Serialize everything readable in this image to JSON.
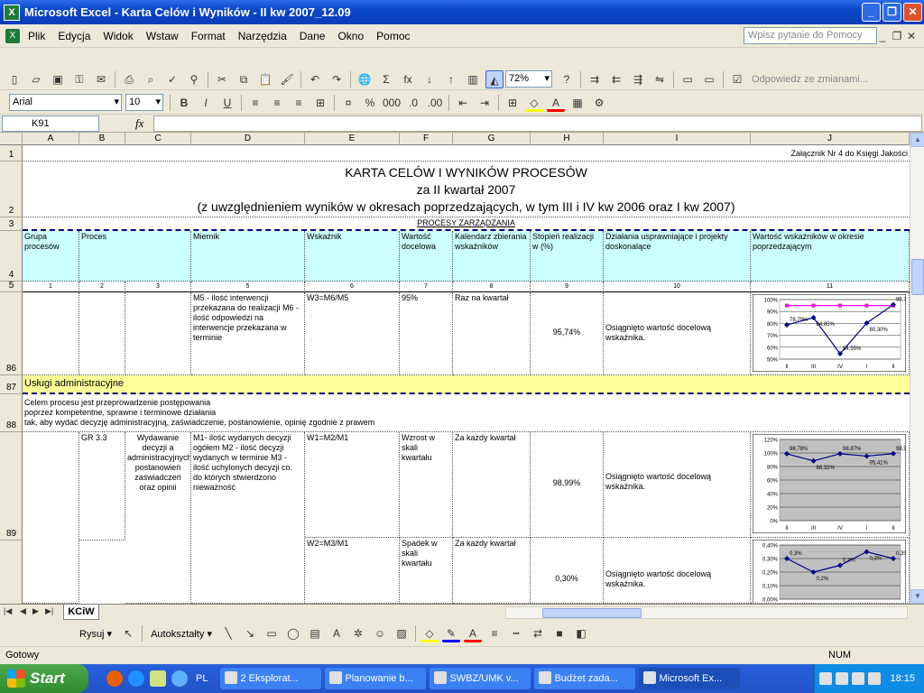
{
  "window": {
    "title": "Microsoft Excel - Karta Celów i Wyników - II kw 2007_12.09",
    "min": "_",
    "max": "❐",
    "close": "✕"
  },
  "menu": [
    "Plik",
    "Edycja",
    "Widok",
    "Wstaw",
    "Format",
    "Narzędzia",
    "Dane",
    "Okno",
    "Pomoc"
  ],
  "help_placeholder": "Wpisz pytanie do Pomocy",
  "zoom": "72%",
  "reply_label": "Odpowiedz ze zmianami...",
  "font": {
    "name": "Arial",
    "size": "10"
  },
  "namebox": "K91",
  "fx": "fx",
  "columns": [
    "A",
    "B",
    "C",
    "D",
    "E",
    "F",
    "G",
    "H",
    "I",
    "J"
  ],
  "rows": {
    "r1": {
      "num": "1",
      "text": "Załącznik Nr 4 do Księgi Jakości"
    },
    "r2": {
      "num": "2",
      "title": "KARTA CELÓW I WYNIKÓW PROCESÓW",
      "sub1": "za II kwartał 2007",
      "sub2": "(z uwzględnieniem wyników w okresach poprzedzających, w tym III i IV kw 2006 oraz I kw 2007)"
    },
    "r3": {
      "num": "3",
      "text": "PROCESY ZARZĄDZANIA"
    },
    "r4": {
      "num": "4",
      "h": [
        "Grupa procesów",
        "Proces",
        "",
        "Miernik",
        "Wskaźnik",
        "Wartość docelowa",
        "Kalendarz zbierania wskaźników",
        "Stopień realizacji w (%)",
        "Działania usprawniające i projekty doskonalące",
        "Wartość wskaźników w okresie poprzedzającym"
      ]
    },
    "r5": {
      "num": "5",
      "n": [
        "1",
        "2",
        "3",
        "5",
        "6",
        "7",
        "8",
        "9",
        "10",
        "11"
      ]
    },
    "r86": {
      "num": "86",
      "miernik": "M5 - ilość interwencji przekazana do realizacji M6 - ilość odpowiedzi na interwencje przekazana w terminie",
      "wskaznik": "W3=M6/M5",
      "docelowa": "95%",
      "kalendarz": "Raz na kwartał",
      "stopien": "95,74%",
      "dzialania": "Osiągnięto wartość docelową wskaźnika."
    },
    "r87": {
      "num": "87",
      "text": "Usługi administracyjne"
    },
    "r88": {
      "num": "88",
      "l1": "Celem procesu jest przeprowadzenie postępowania",
      "l2": "poprzez kompetentne, sprawne i terminowe działania",
      "l3": "tak, aby wydać decyzję administracyjną, zaświadczenie, postanowienie, opinię zgodnie z prawem"
    },
    "r89": {
      "num": "89",
      "proces": "GR 3.3",
      "opis": "Wydawanie decyzji a administracyjnych, postanowień zaświadczeń oraz opinii",
      "miernik": "M1- ilość wydanych decyzji ogółem M2 - ilość decyzji wydanych w terminie M3 - ilość uchylonych decyzji co. do których stwierdzono nieważność",
      "wskaznik": "W1=M2/M1",
      "docelowa": "Wzrost w skali kwartału",
      "kalendarz": "Za każdy kwartał",
      "stopien": "98,99%",
      "dzialania": "Osiągnięto wartość docelową wskaźnika."
    },
    "r90": {
      "wskaznik": "W2=M3/M1",
      "docelowa": "Spadek w skali kwartału",
      "kalendarz": "Za każdy kwartał",
      "stopien": "0,30%",
      "dzialania": "Osiągnięto wartość docelową wskaźnika."
    }
  },
  "chart_data": [
    {
      "type": "line",
      "categories": [
        "II",
        "III",
        "IV",
        "I",
        "II"
      ],
      "yticks": [
        "100%",
        "90%",
        "80%",
        "70%",
        "60%",
        "50%"
      ],
      "ylim": [
        0.5,
        1.0
      ],
      "series": [
        {
          "values": [
            0.95,
            0.95,
            0.95,
            0.95,
            0.95
          ],
          "color": "#ff00ff"
        },
        {
          "values": [
            0.7875,
            0.8485,
            0.5455,
            0.803,
            0.9574
          ],
          "color": "#00008b"
        }
      ],
      "labels": [
        "78,79%",
        "84,85%",
        "54,55%",
        "80,30%",
        "95,74%"
      ],
      "colors": {
        "bg": "#ffffff",
        "line": "#00008b"
      }
    },
    {
      "type": "line",
      "categories": [
        "II",
        "III",
        "IV",
        "I",
        "II"
      ],
      "yticks": [
        "120%",
        "100%",
        "80%",
        "60%",
        "40%",
        "20%",
        "0%"
      ],
      "ylim": [
        0,
        1.2
      ],
      "series": [
        {
          "values": [
            0.9878,
            0.8832,
            0.9887,
            0.9541,
            0.9899
          ],
          "color": "#00008b"
        }
      ],
      "labels": [
        "98,78%",
        "88,32%",
        "98,87%",
        "95,41%",
        "98,99%"
      ],
      "colors": {
        "bg": "#c0c0c0",
        "line": "#00008b"
      }
    },
    {
      "type": "line",
      "categories": [
        "II",
        "III",
        "IV",
        "I",
        "II"
      ],
      "yticks": [
        "0,40%",
        "0,30%",
        "0,20%",
        "0,10%",
        "0,00%"
      ],
      "ylim": [
        0,
        0.4
      ],
      "series": [
        {
          "values": [
            0.3,
            0.2,
            0.25,
            0.35,
            0.3
          ],
          "color": "#00008b"
        }
      ],
      "labels": [
        "0,3%",
        "0,2%",
        "0,3%",
        "0,3%",
        "0,3%"
      ],
      "colors": {
        "bg": "#c0c0c0",
        "line": "#00008b"
      }
    }
  ],
  "sheet_tab": "KCiW",
  "draw": {
    "rysuj": "Rysuj ▾",
    "autoksztalty": "Autokształty ▾"
  },
  "status": {
    "left": "Gotowy",
    "num": "NUM"
  },
  "taskbar": {
    "start": "Start",
    "lang": "PL",
    "tasks": [
      "2 Eksplorat...",
      "Planowanie b...",
      "SWBZ/UMK v...",
      "Budżet zada...",
      "Microsoft Ex..."
    ],
    "clock": "18:15"
  }
}
